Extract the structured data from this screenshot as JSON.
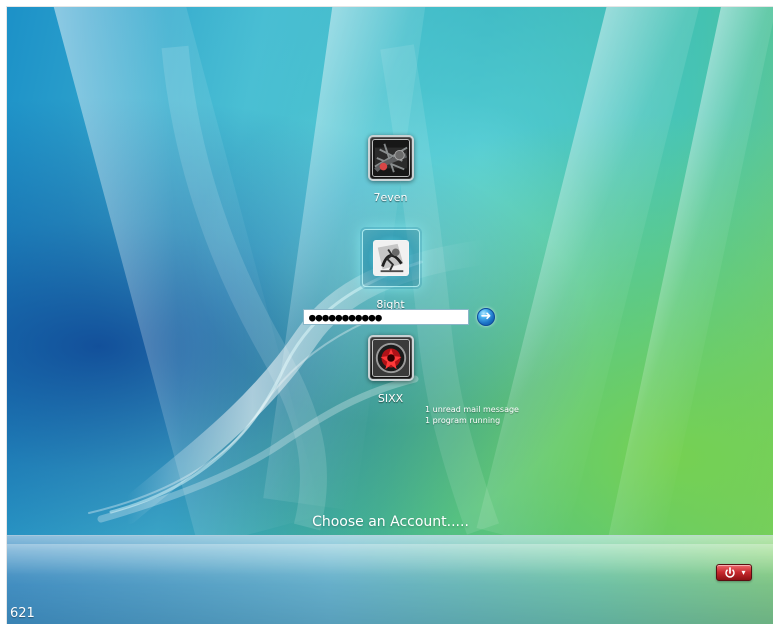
{
  "login_screen": {
    "accounts": [
      {
        "name": "7even",
        "avatar_icon": "dark-mechanical-avatar-icon"
      },
      {
        "name": "8ight",
        "avatar_icon": "comic-avatar-icon",
        "selected": true
      },
      {
        "name": "SIXX",
        "avatar_icon": "red-emblem-avatar-icon",
        "status_lines": [
          "1 unread mail message",
          "1 program running"
        ]
      }
    ],
    "password": {
      "masked_value": "●●●●●●●●●●●",
      "submit_icon": "arrow-right-icon"
    },
    "prompt": "Choose an Account.....",
    "power": {
      "icon": "power-icon",
      "menu_icon": "chevron-down-icon"
    },
    "corner_number": "621",
    "colors": {
      "sky_blue": "#1c91c8",
      "aqua": "#42b6cf",
      "green": "#76cb70",
      "password_submit": "#1d74c7",
      "power_red": "#c7292e"
    }
  }
}
